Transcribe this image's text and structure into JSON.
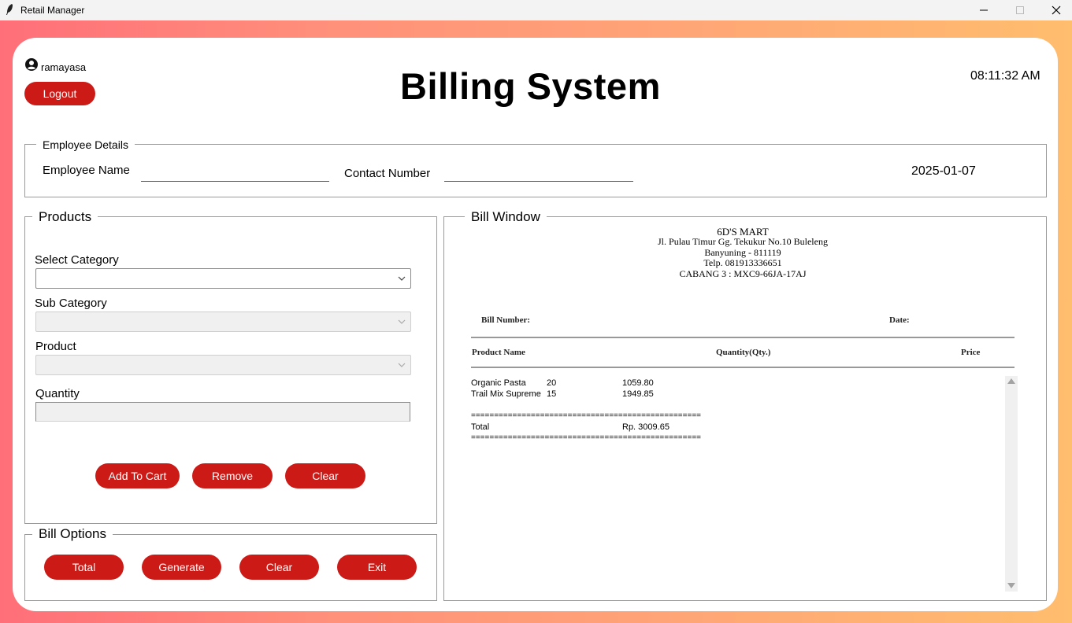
{
  "window": {
    "title": "Retail Manager"
  },
  "header": {
    "username": "ramayasa",
    "logout_label": "Logout",
    "title": "Billing System",
    "clock": "08:11:32 AM"
  },
  "employee": {
    "legend": "Employee Details",
    "name_label": "Employee Name",
    "name_value": "",
    "contact_label": "Contact Number",
    "contact_value": "",
    "date": "2025-01-07"
  },
  "products": {
    "legend": "Products",
    "category_label": "Select Category",
    "category_value": "",
    "subcategory_label": "Sub Category",
    "subcategory_value": "",
    "product_label": "Product",
    "product_value": "",
    "quantity_label": "Quantity",
    "quantity_value": "",
    "add_label": "Add To Cart",
    "remove_label": "Remove",
    "clear_label": "Clear"
  },
  "bill_options": {
    "legend": "Bill Options",
    "total_label": "Total",
    "generate_label": "Generate",
    "clear_label": "Clear",
    "exit_label": "Exit"
  },
  "bill_window": {
    "legend": "Bill Window",
    "store_name": "6D'S MART",
    "address_1": "Jl. Pulau Timur Gg. Tekukur No.10 Buleleng",
    "address_2": "Banyuning - 811119",
    "phone": "Telp. 081913336651",
    "branch": "CABANG 3 : MXC9-66JA-17AJ",
    "bill_number_label": "Bill Number:",
    "date_label": "Date:",
    "col_product": "Product Name",
    "col_qty": "Quantity(Qty.)",
    "col_price": "Price",
    "items": [
      {
        "name": "Organic Pasta",
        "qty": "20",
        "price": "1059.80"
      },
      {
        "name": "Trail Mix Supreme",
        "qty": "15",
        "price": "1949.85"
      }
    ],
    "separator": "==================================================",
    "total_label": "Total",
    "total_value": "Rp. 3009.65"
  },
  "colors": {
    "accent": "#cc1b17",
    "border": "#9a9a9a"
  }
}
